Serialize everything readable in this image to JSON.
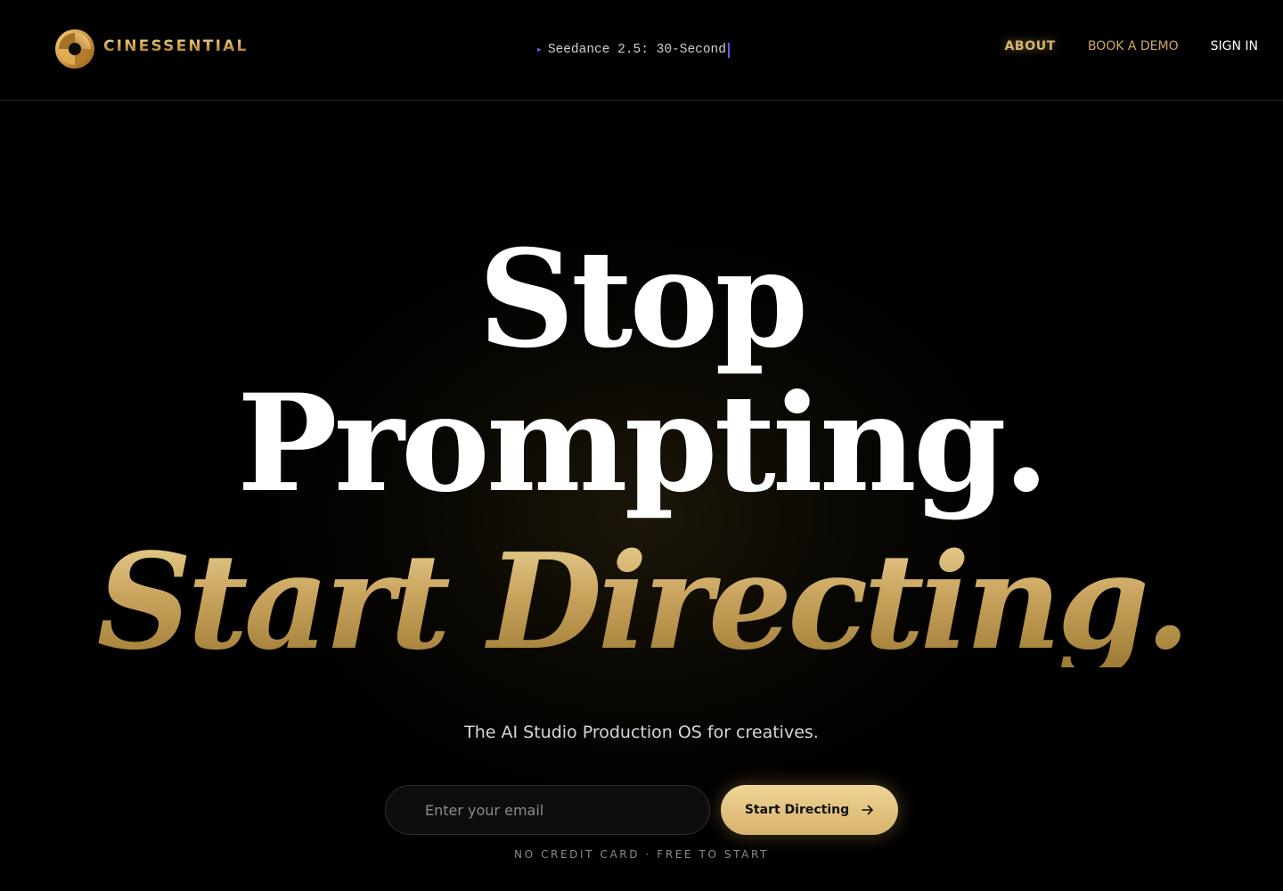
{
  "nav": {
    "brand_name": "CINESSENTIAL",
    "ticker_text": "Seedance 2.5: 30-Second",
    "links": {
      "about": "ABOUT",
      "book_demo": "BOOK A DEMO",
      "sign_in": "SIGN IN"
    }
  },
  "hero": {
    "line1": "Stop",
    "line2": "Prompting.",
    "line3": "Start Directing.",
    "tagline": "The AI Studio Production OS for creatives.",
    "email_placeholder": "Enter your email",
    "cta_label": "Start Directing",
    "fineprint": "NO CREDIT CARD · FREE TO START"
  },
  "icons": {
    "logo": "aperture-logo-icon",
    "ticker": "play-triangle-icon",
    "cta": "arrow-right-icon"
  },
  "colors": {
    "background": "#000000",
    "gold_light": "#f0d596",
    "gold": "#d6b36b",
    "gold_dark": "#9e7b34",
    "cursor": "#6b55e0"
  }
}
